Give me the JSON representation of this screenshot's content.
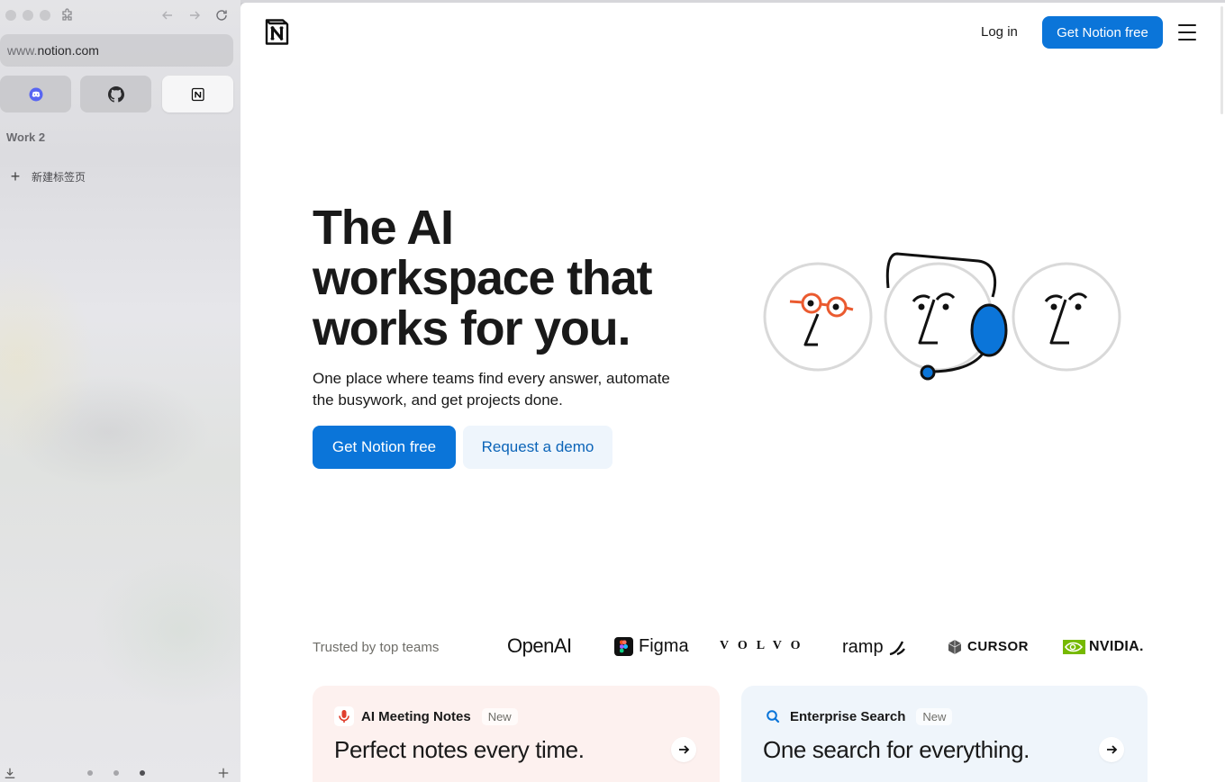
{
  "browser": {
    "url_prefix": "www.",
    "url_domain": "notion.com",
    "space_name": "Work 2",
    "new_tab_label": "新建标签页"
  },
  "nav": {
    "login": "Log in",
    "cta": "Get Notion free"
  },
  "hero": {
    "title": "The AI workspace that works for you.",
    "subtitle": "One place where teams find every answer, automate the busywork, and get projects done.",
    "primary_cta": "Get Notion free",
    "secondary_cta": "Request a demo"
  },
  "trusted": {
    "label": "Trusted by top teams",
    "logos": [
      "OpenAI",
      "Figma",
      "VOLVO",
      "ramp",
      "CURSOR",
      "NVIDIA."
    ]
  },
  "cards": [
    {
      "label": "AI Meeting Notes",
      "badge": "New",
      "title": "Perfect notes every time."
    },
    {
      "label": "Enterprise Search",
      "badge": "New",
      "title": "One search for everything."
    }
  ],
  "colors": {
    "accent": "#0b75d9",
    "card_pink": "#fdf1ef",
    "card_blue": "#eff5fb",
    "face_blue": "#0b75d9",
    "glasses_orange": "#ea5a2f"
  }
}
